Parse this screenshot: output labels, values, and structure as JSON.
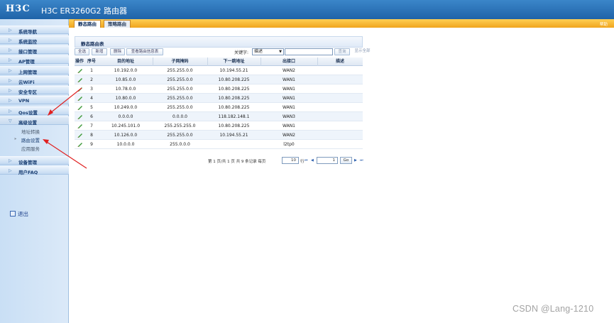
{
  "header": {
    "logo": "H3C",
    "title": "H3C ER3260G2 路由器"
  },
  "sidebar": {
    "items": [
      {
        "label": "系统导航",
        "arrow": "▷"
      },
      {
        "label": "系统监控",
        "arrow": "▷"
      },
      {
        "label": "接口管理",
        "arrow": "▷"
      },
      {
        "label": "AP管理",
        "arrow": "▷"
      },
      {
        "label": "上网管理",
        "arrow": "▷"
      },
      {
        "label": "云WiFi",
        "arrow": "▷"
      },
      {
        "label": "安全专区",
        "arrow": "▷"
      },
      {
        "label": "VPN",
        "arrow": "▷"
      },
      {
        "label": "Qos设置",
        "arrow": "▷"
      },
      {
        "label": "高级设置",
        "arrow": "▽"
      }
    ],
    "subitems": [
      {
        "label": "地址转换"
      },
      {
        "label": "路由设置",
        "marker": "»"
      },
      {
        "label": "应用服务"
      }
    ],
    "items_after": [
      {
        "label": "设备管理",
        "arrow": "▷"
      },
      {
        "label": "用户FAQ",
        "arrow": "▷"
      }
    ],
    "logout": "退出"
  },
  "tabs": [
    {
      "label": "静态路由",
      "active": true
    },
    {
      "label": "策略路由",
      "active": false
    }
  ],
  "help": "帮助",
  "panel": {
    "title": "静态路由表",
    "toolbar": {
      "select_all": "全选",
      "add": "新增",
      "delete": "删除",
      "view_info": "查看路由信息表",
      "keyword_label": "关键字:",
      "keyword_value": "描述",
      "search": "查询",
      "show_all": "显示全部"
    },
    "columns": [
      "操作",
      "序号",
      "目的地址",
      "子网掩码",
      "下一跳地址",
      "出接口",
      "描述"
    ],
    "rows": [
      {
        "seq": "1",
        "dst": "10.192.0.0",
        "mask": "255.255.0.0",
        "hop": "10.194.55.21",
        "iface": "WAN2",
        "desc": ""
      },
      {
        "seq": "2",
        "dst": "10.85.0.0",
        "mask": "255.255.0.0",
        "hop": "10.80.208.225",
        "iface": "WAN1",
        "desc": ""
      },
      {
        "seq": "3",
        "dst": "10.78.0.0",
        "mask": "255.255.0.0",
        "hop": "10.80.208.225",
        "iface": "WAN1",
        "desc": ""
      },
      {
        "seq": "4",
        "dst": "10.80.0.0",
        "mask": "255.255.0.0",
        "hop": "10.80.208.225",
        "iface": "WAN1",
        "desc": ""
      },
      {
        "seq": "5",
        "dst": "10.249.0.0",
        "mask": "255.255.0.0",
        "hop": "10.80.208.225",
        "iface": "WAN1",
        "desc": ""
      },
      {
        "seq": "6",
        "dst": "0.0.0.0",
        "mask": "0.0.0.0",
        "hop": "118.182.148.1",
        "iface": "WAN3",
        "desc": ""
      },
      {
        "seq": "7",
        "dst": "10.245.101.0",
        "mask": "255.255.255.0",
        "hop": "10.80.208.225",
        "iface": "WAN1",
        "desc": ""
      },
      {
        "seq": "8",
        "dst": "10.126.0.0",
        "mask": "255.255.0.0",
        "hop": "10.194.55.21",
        "iface": "WAN2",
        "desc": ""
      },
      {
        "seq": "9",
        "dst": "10.0.0.0",
        "mask": "255.0.0.0",
        "hop": "",
        "iface": "l2tp0",
        "desc": ""
      }
    ],
    "pager": {
      "summary": "第 1 页/共 1 页 共 9 条记录 每页",
      "per_page": "10",
      "rows_label": "行",
      "page": "1",
      "go": "Go"
    }
  },
  "watermark": "CSDN @Lang-1210",
  "colors": {
    "header": "#2a73b8",
    "tabbar": "#f5b52e",
    "sidebar": "#cfe2f6",
    "annotation": "#e02020"
  }
}
